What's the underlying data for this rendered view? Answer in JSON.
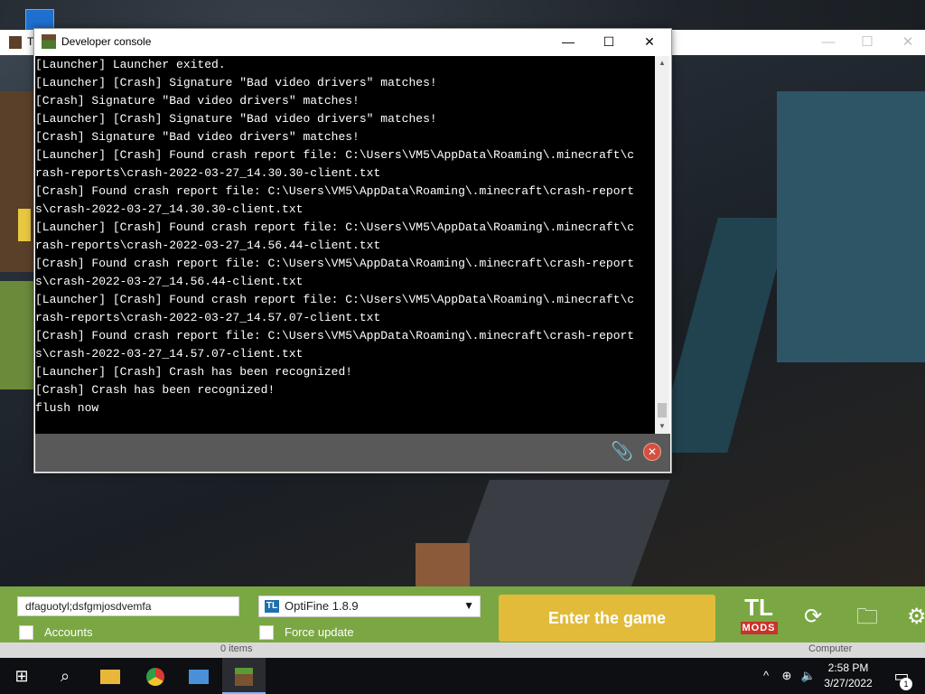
{
  "launcher": {
    "title": "T",
    "nickname_value": "dfaguotyl;dsfgmjosdvemfa",
    "accounts_label": "Accounts",
    "version_selected": "OptiFine 1.8.9",
    "version_icon": "TL",
    "force_update_label": "Force update",
    "enter_button": "Enter the game",
    "logo_top": "TL",
    "logo_bottom": "MODS",
    "footer_items": "0 items",
    "footer_computer": "Computer",
    "icons": [
      "refresh-icon",
      "folder-icon",
      "settings-icon"
    ]
  },
  "console": {
    "title": "Developer console",
    "controls": {
      "minimize": "—",
      "maximize": "☐",
      "close": "✕"
    },
    "log_lines": [
      "[Launcher] Launcher exited.",
      "[Launcher] [Crash] Signature \"Bad video drivers\" matches!",
      "[Crash] Signature \"Bad video drivers\" matches!",
      "[Launcher] [Crash] Signature \"Bad video drivers\" matches!",
      "[Crash] Signature \"Bad video drivers\" matches!",
      "[Launcher] [Crash] Found crash report file: C:\\Users\\VM5\\AppData\\Roaming\\.minecraft\\c",
      "rash-reports\\crash-2022-03-27_14.30.30-client.txt",
      "[Crash] Found crash report file: C:\\Users\\VM5\\AppData\\Roaming\\.minecraft\\crash-report",
      "s\\crash-2022-03-27_14.30.30-client.txt",
      "[Launcher] [Crash] Found crash report file: C:\\Users\\VM5\\AppData\\Roaming\\.minecraft\\c",
      "rash-reports\\crash-2022-03-27_14.56.44-client.txt",
      "[Crash] Found crash report file: C:\\Users\\VM5\\AppData\\Roaming\\.minecraft\\crash-report",
      "s\\crash-2022-03-27_14.56.44-client.txt",
      "[Launcher] [Crash] Found crash report file: C:\\Users\\VM5\\AppData\\Roaming\\.minecraft\\c",
      "rash-reports\\crash-2022-03-27_14.57.07-client.txt",
      "[Crash] Found crash report file: C:\\Users\\VM5\\AppData\\Roaming\\.minecraft\\crash-report",
      "s\\crash-2022-03-27_14.57.07-client.txt",
      "[Launcher] [Crash] Crash has been recognized!",
      "[Crash] Crash has been recognized!",
      "flush now"
    ],
    "icons": {
      "attach": "paperclip-icon",
      "clear": "clear-icon"
    }
  },
  "taskbar": {
    "apps": [
      "start-icon",
      "search-icon",
      "file-explorer-icon",
      "chrome-icon",
      "control-panel-icon",
      "minecraft-icon"
    ],
    "time": "2:58 PM",
    "date": "3/27/2022",
    "notification_count": "1"
  },
  "colors": {
    "launcher_bar": "#7aa743",
    "enter_button": "#e2bb3a",
    "console_bg": "#000000",
    "console_footer": "#595959",
    "taskbar": "#0e0f12"
  }
}
